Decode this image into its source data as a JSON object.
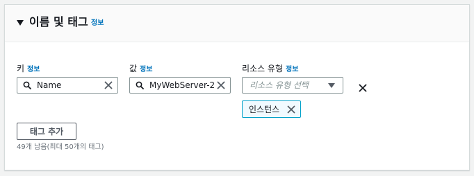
{
  "panel": {
    "title": "이름 및 태그",
    "info": "정보"
  },
  "fields": {
    "key": {
      "label": "키",
      "info": "정보",
      "value": "Name"
    },
    "value": {
      "label": "값",
      "info": "정보",
      "value": "MyWebServer-2"
    },
    "resource_type": {
      "label": "리소스 유형",
      "info": "정보",
      "placeholder": "리소스 유형 선택",
      "tokens": [
        "인스턴스"
      ]
    }
  },
  "add_tag_button": "태그 추가",
  "remaining_hint": "49개 남음(최대 50개의 태그)",
  "colors": {
    "info_link": "#0073bb",
    "token_border": "#00a1c9",
    "token_bg": "#f1faff"
  }
}
